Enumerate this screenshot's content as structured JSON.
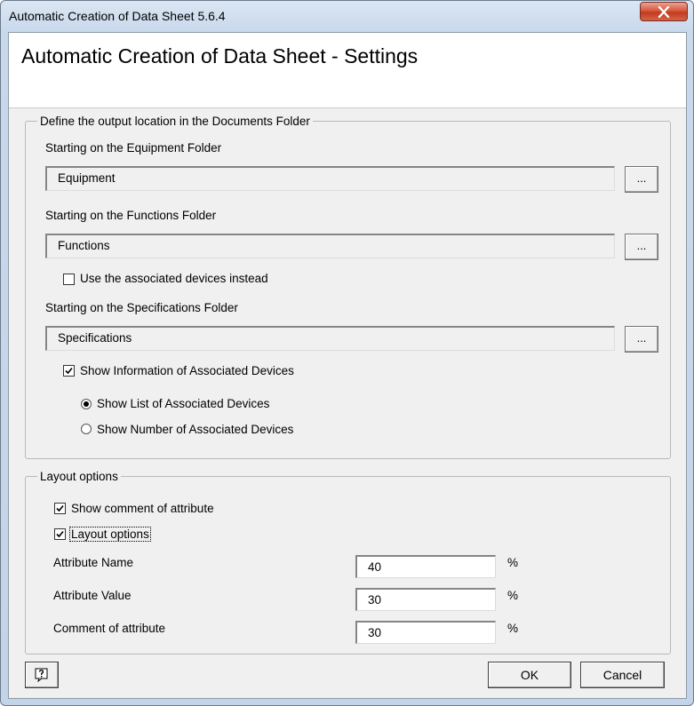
{
  "window": {
    "title": "Automatic Creation of Data Sheet 5.6.4"
  },
  "header": {
    "title": "Automatic Creation of Data Sheet - Settings"
  },
  "output_group": {
    "legend": "Define the output location in the Documents Folder",
    "equipment": {
      "label": "Starting on the Equipment Folder",
      "value": "Equipment",
      "browse_label": "..."
    },
    "functions": {
      "label": "Starting on the Functions Folder",
      "value": "Functions",
      "browse_label": "..."
    },
    "use_associated_devices": {
      "label": "Use the associated devices instead",
      "checked": false
    },
    "specifications": {
      "label": "Starting on the Specifications Folder",
      "value": "Specifications",
      "browse_label": "..."
    },
    "show_info_associated": {
      "label": "Show Information of Associated Devices",
      "checked": true
    },
    "radio_options": [
      {
        "label": "Show List of Associated Devices",
        "selected": true
      },
      {
        "label": "Show Number of Associated Devices",
        "selected": false
      }
    ]
  },
  "layout_group": {
    "legend": "Layout options",
    "show_comment": {
      "label": "Show comment of attribute",
      "checked": true
    },
    "layout_options": {
      "label": "Layout options",
      "checked": true
    },
    "fields": [
      {
        "label": "Attribute Name",
        "value": "40",
        "unit": "%"
      },
      {
        "label": "Attribute Value",
        "value": "30",
        "unit": "%"
      },
      {
        "label": "Comment of attribute",
        "value": "30",
        "unit": "%"
      }
    ]
  },
  "footer": {
    "ok_label": "OK",
    "cancel_label": "Cancel",
    "help_icon": "help-icon"
  },
  "colors": {
    "close_button": "#c23a1e",
    "title_bar": "#c9d9ec",
    "dialog_bg": "#f0f0f0"
  }
}
